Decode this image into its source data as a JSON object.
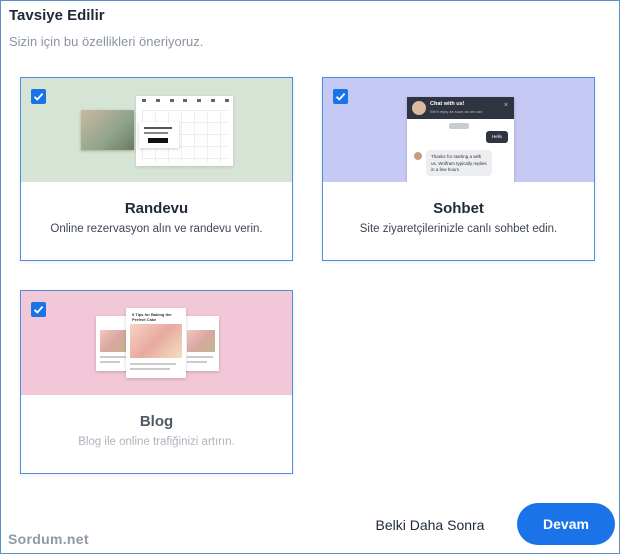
{
  "header": {
    "title": "Tavsiye Edilir",
    "subtitle": "Sizin için bu özellikleri öneriyoruz."
  },
  "cards": [
    {
      "title": "Randevu",
      "description": "Online rezervasyon alın ve randevu verin.",
      "checked": true,
      "banner_color": "#d6e4d6"
    },
    {
      "title": "Sohbet",
      "description": "Site ziyaretçilerinizle canlı sohbet edin.",
      "checked": true,
      "banner_color": "#c6c9f4",
      "preview": {
        "chat_title": "Chat with us!",
        "chat_status": "We'll reply as soon as we can",
        "close": "×",
        "user_message": "Hello",
        "agent_reply": "Thanks for starting a with us, Wolfram typically replies in a few hours"
      }
    },
    {
      "title": "Blog",
      "description": "Blog ile online trafiğinizi artırın.",
      "checked": true,
      "banner_color": "#f2c7d8",
      "preview": {
        "center_post_title": "5 Tips for Baking the Perfect Cake"
      }
    }
  ],
  "actions": {
    "later_label": "Belki Daha Sonra",
    "continue_label": "Devam"
  },
  "watermark": "Sordum.net",
  "colors": {
    "accent": "#1a73e8",
    "card_border": "#4a8ee6"
  }
}
